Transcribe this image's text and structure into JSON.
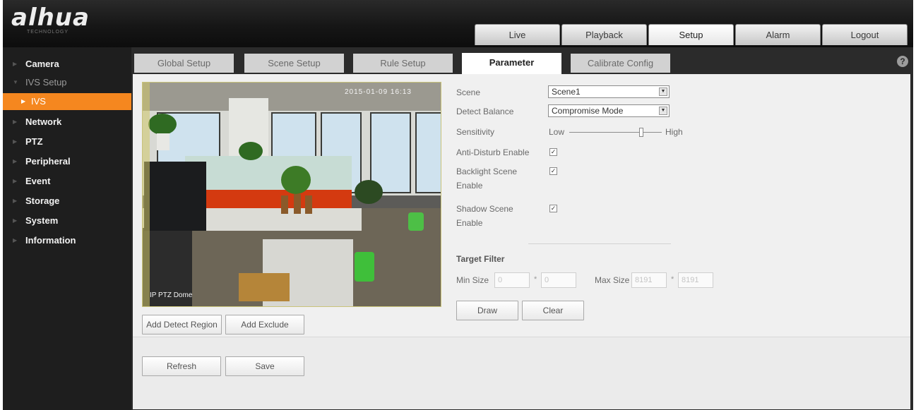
{
  "header": {
    "logo_text": "alhua",
    "logo_sub": "TECHNOLOGY",
    "nav": [
      {
        "label": "Live"
      },
      {
        "label": "Playback"
      },
      {
        "label": "Setup",
        "active": true
      },
      {
        "label": "Alarm"
      },
      {
        "label": "Logout"
      }
    ]
  },
  "sidebar": {
    "items": [
      {
        "label": "Camera"
      },
      {
        "label": "IVS Setup"
      },
      {
        "label": "IVS"
      },
      {
        "label": "Network"
      },
      {
        "label": "PTZ"
      },
      {
        "label": "Peripheral"
      },
      {
        "label": "Event"
      },
      {
        "label": "Storage"
      },
      {
        "label": "System"
      },
      {
        "label": "Information"
      }
    ]
  },
  "tabs": [
    {
      "label": "Global Setup"
    },
    {
      "label": "Scene Setup"
    },
    {
      "label": "Rule Setup"
    },
    {
      "label": "Parameter",
      "active": true
    },
    {
      "label": "Calibrate Config"
    }
  ],
  "video": {
    "osd_time": "2015-01-09 16:13",
    "osd_name": "IP PTZ Dome"
  },
  "buttons": {
    "add_detect_region": "Add Detect Region",
    "add_exclude": "Add Exclude",
    "draw": "Draw",
    "clear": "Clear",
    "refresh": "Refresh",
    "save": "Save"
  },
  "form": {
    "scene_label": "Scene",
    "scene_value": "Scene1",
    "detect_balance_label": "Detect Balance",
    "detect_balance_value": "Compromise Mode",
    "sensitivity_label": "Sensitivity",
    "sensitivity_low": "Low",
    "sensitivity_high": "High",
    "sensitivity_level": 0.78,
    "anti_disturb_label": "Anti-Disturb Enable",
    "backlight_label_1": "Backlight Scene",
    "backlight_label_2": "Enable",
    "shadow_label_1": "Shadow Scene",
    "shadow_label_2": "Enable",
    "checkmark": "✓",
    "target_filter_title": "Target Filter",
    "min_size_label": "Min Size",
    "min_w": "0",
    "min_h": "0",
    "max_size_label": "Max Size",
    "max_w": "8191",
    "max_h": "8191",
    "times": "*"
  },
  "icons": {
    "help": "?",
    "dropdown": "▼",
    "collapsed_arrow": "▶",
    "expanded_arrow": "▼"
  },
  "colors": {
    "accent_orange": "#f5871f",
    "sidebar_bg": "#1e1e1e",
    "panel_bg": "#f0f0f0"
  }
}
